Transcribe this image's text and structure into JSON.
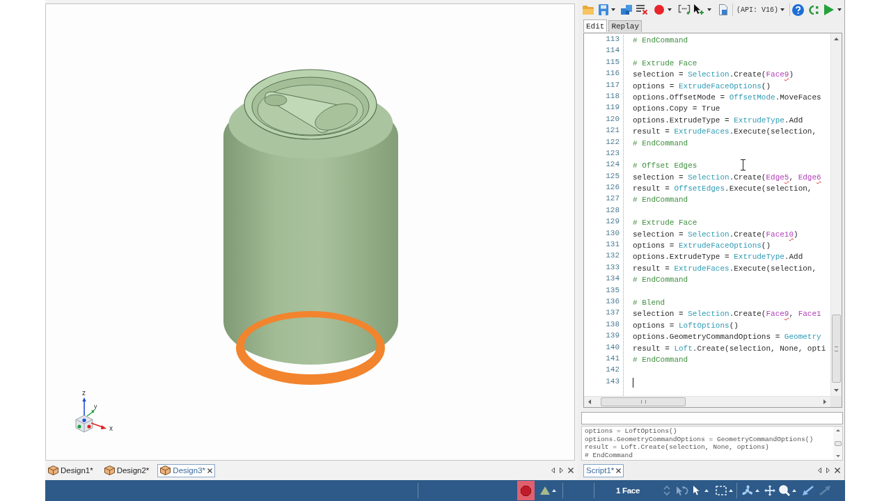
{
  "viewport": {
    "axis_labels": [
      "z",
      "y",
      "x"
    ]
  },
  "document_tabs": [
    {
      "label": "Design1*",
      "selected": false
    },
    {
      "label": "Design2*",
      "selected": false
    },
    {
      "label": "Design3*",
      "selected": true
    }
  ],
  "script_toolbar": {
    "api_version": "(API: V16)"
  },
  "script_mode_tabs": [
    {
      "label": "Edit",
      "selected": true
    },
    {
      "label": "Replay",
      "selected": false
    }
  ],
  "editor": {
    "lines": [
      {
        "number": "113",
        "caret": false,
        "tokens": [
          {
            "kind": "comment",
            "text": "# EndCommand"
          }
        ]
      },
      {
        "number": "114",
        "caret": false
      },
      {
        "number": "115",
        "caret": false,
        "tokens": [
          {
            "kind": "comment",
            "text": "# Extrude Face"
          }
        ]
      },
      {
        "number": "116",
        "caret": false,
        "tokens": [
          {
            "kind": "plain",
            "text": "selection = "
          },
          {
            "kind": "type",
            "text": "Selection"
          },
          {
            "kind": "plain",
            "text": ".Create("
          },
          {
            "kind": "ref",
            "text": "Face"
          },
          {
            "kind": "ref_flagged",
            "text": "9"
          },
          {
            "kind": "plain",
            "text": ")"
          }
        ]
      },
      {
        "number": "117",
        "caret": false,
        "tokens": [
          {
            "kind": "plain",
            "text": "options = "
          },
          {
            "kind": "type",
            "text": "ExtrudeFaceOptions"
          },
          {
            "kind": "plain",
            "text": "()"
          }
        ]
      },
      {
        "number": "118",
        "caret": false,
        "tokens": [
          {
            "kind": "plain",
            "text": "options.OffsetMode = "
          },
          {
            "kind": "type",
            "text": "OffsetMode"
          },
          {
            "kind": "plain",
            "text": ".MoveFaces"
          }
        ]
      },
      {
        "number": "119",
        "caret": false,
        "tokens": [
          {
            "kind": "plain",
            "text": "options.Copy = True"
          }
        ]
      },
      {
        "number": "120",
        "caret": false,
        "tokens": [
          {
            "kind": "plain",
            "text": "options.ExtrudeType = "
          },
          {
            "kind": "type",
            "text": "ExtrudeType"
          },
          {
            "kind": "plain",
            "text": ".Add"
          }
        ]
      },
      {
        "number": "121",
        "caret": false,
        "tokens": [
          {
            "kind": "plain",
            "text": "result = "
          },
          {
            "kind": "type",
            "text": "ExtrudeFaces"
          },
          {
            "kind": "plain",
            "text": ".Execute(selection,"
          }
        ]
      },
      {
        "number": "122",
        "caret": false,
        "tokens": [
          {
            "kind": "comment",
            "text": "# EndCommand"
          }
        ]
      },
      {
        "number": "123",
        "caret": false
      },
      {
        "number": "124",
        "caret": false,
        "tokens": [
          {
            "kind": "comment",
            "text": "# Offset Edges"
          }
        ]
      },
      {
        "number": "125",
        "caret": false,
        "tokens": [
          {
            "kind": "plain",
            "text": "selection = "
          },
          {
            "kind": "type",
            "text": "Selection"
          },
          {
            "kind": "plain",
            "text": ".Create("
          },
          {
            "kind": "ref",
            "text": "Edge"
          },
          {
            "kind": "ref_flagged",
            "text": "5"
          },
          {
            "kind": "plain",
            "text": ", "
          },
          {
            "kind": "ref",
            "text": "Edge"
          },
          {
            "kind": "ref_flagged",
            "text": "6"
          }
        ]
      },
      {
        "number": "126",
        "caret": false,
        "tokens": [
          {
            "kind": "plain",
            "text": "result = "
          },
          {
            "kind": "type",
            "text": "OffsetEdges"
          },
          {
            "kind": "plain",
            "text": ".Execute(selection,"
          }
        ]
      },
      {
        "number": "127",
        "caret": false,
        "tokens": [
          {
            "kind": "comment",
            "text": "# EndCommand"
          }
        ]
      },
      {
        "number": "128",
        "caret": false
      },
      {
        "number": "129",
        "caret": false,
        "tokens": [
          {
            "kind": "comment",
            "text": "# Extrude Face"
          }
        ]
      },
      {
        "number": "130",
        "caret": false,
        "tokens": [
          {
            "kind": "plain",
            "text": "selection = "
          },
          {
            "kind": "type",
            "text": "Selection"
          },
          {
            "kind": "plain",
            "text": ".Create("
          },
          {
            "kind": "ref",
            "text": "Face1"
          },
          {
            "kind": "ref_flagged",
            "text": "0"
          },
          {
            "kind": "plain",
            "text": ")"
          }
        ]
      },
      {
        "number": "131",
        "caret": false,
        "tokens": [
          {
            "kind": "plain",
            "text": "options = "
          },
          {
            "kind": "type",
            "text": "ExtrudeFaceOptions"
          },
          {
            "kind": "plain",
            "text": "()"
          }
        ]
      },
      {
        "number": "132",
        "caret": false,
        "tokens": [
          {
            "kind": "plain",
            "text": "options.ExtrudeType = "
          },
          {
            "kind": "type",
            "text": "ExtrudeType"
          },
          {
            "kind": "plain",
            "text": ".Add"
          }
        ]
      },
      {
        "number": "133",
        "caret": false,
        "tokens": [
          {
            "kind": "plain",
            "text": "result = "
          },
          {
            "kind": "type",
            "text": "ExtrudeFaces"
          },
          {
            "kind": "plain",
            "text": ".Execute(selection,"
          }
        ]
      },
      {
        "number": "134",
        "caret": false,
        "tokens": [
          {
            "kind": "comment",
            "text": "# EndCommand"
          }
        ]
      },
      {
        "number": "135",
        "caret": false
      },
      {
        "number": "136",
        "caret": false,
        "tokens": [
          {
            "kind": "comment",
            "text": "# Blend"
          }
        ]
      },
      {
        "number": "137",
        "caret": false,
        "tokens": [
          {
            "kind": "plain",
            "text": "selection = "
          },
          {
            "kind": "type",
            "text": "Selection"
          },
          {
            "kind": "plain",
            "text": ".Create("
          },
          {
            "kind": "ref",
            "text": "Face"
          },
          {
            "kind": "ref_flagged",
            "text": "9"
          },
          {
            "kind": "plain",
            "text": ", "
          },
          {
            "kind": "ref",
            "text": "Face1"
          }
        ]
      },
      {
        "number": "138",
        "caret": false,
        "tokens": [
          {
            "kind": "plain",
            "text": "options = "
          },
          {
            "kind": "type",
            "text": "LoftOptions"
          },
          {
            "kind": "plain",
            "text": "()"
          }
        ]
      },
      {
        "number": "139",
        "caret": false,
        "tokens": [
          {
            "kind": "plain",
            "text": "options.GeometryCommandOptions = "
          },
          {
            "kind": "type",
            "text": "Geometry"
          }
        ]
      },
      {
        "number": "140",
        "caret": false,
        "tokens": [
          {
            "kind": "plain",
            "text": "result = "
          },
          {
            "kind": "type",
            "text": "Loft"
          },
          {
            "kind": "plain",
            "text": ".Create(selection, None, opti"
          }
        ]
      },
      {
        "number": "141",
        "caret": false,
        "tokens": [
          {
            "kind": "comment",
            "text": "# EndCommand"
          }
        ]
      },
      {
        "number": "142",
        "caret": false
      },
      {
        "number": "143",
        "caret": true
      }
    ]
  },
  "output": {
    "lines": [
      "options = LoftOptions()",
      "options.GeometryCommandOptions = GeometryCommandOptions()",
      "result = Loft.Create(selection, None, options)",
      "# EndCommand"
    ]
  },
  "script_tabs": [
    {
      "label": "Script1*",
      "selected": true
    }
  ],
  "status_bar": {
    "recording": true,
    "selection": "1 Face"
  }
}
